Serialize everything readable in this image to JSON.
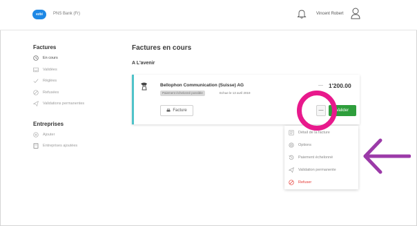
{
  "header": {
    "logo_text": "ezbi",
    "bank_name": "PNS Bank (Fr)",
    "user_name": "Vincent Robert"
  },
  "sidebar": {
    "invoices_title": "Factures",
    "invoice_items": [
      {
        "label": "En cours",
        "icon": "clock-icon",
        "active": true
      },
      {
        "label": "Validées",
        "icon": "inbox-icon",
        "active": false
      },
      {
        "label": "Réglées",
        "icon": "check-icon",
        "active": false
      },
      {
        "label": "Refusées",
        "icon": "cancel-icon",
        "active": false
      },
      {
        "label": "Validations permanentes",
        "icon": "send-icon",
        "active": false
      }
    ],
    "companies_title": "Entreprises",
    "company_items": [
      {
        "label": "Ajouter",
        "icon": "add-icon"
      },
      {
        "label": "Entreprises ajoutées",
        "icon": "building-icon"
      }
    ]
  },
  "main": {
    "title": "Factures en cours",
    "subtitle": "A L'avenir",
    "card": {
      "company": "Bellophon Communication (Suisse) AG",
      "tag": "Paiement échelonné possible",
      "due": "Echue le 13 avril 2019",
      "amount_dash": "—",
      "amount": "1'200.00",
      "invoice_button": "Facture",
      "more_button": "—",
      "validate_button": "Valider"
    }
  },
  "dropdown": {
    "items": [
      {
        "label": "Détail de la facture",
        "icon": "document-icon",
        "danger": false
      },
      {
        "label": "Options",
        "icon": "settings-icon",
        "danger": false
      },
      {
        "label": "Paiement échelonné",
        "icon": "history-icon",
        "danger": false
      },
      {
        "label": "Validation permanente",
        "icon": "send-icon",
        "danger": false
      },
      {
        "label": "Refuser",
        "icon": "cancel-icon",
        "danger": true
      }
    ]
  },
  "colors": {
    "accent_green": "#2e9e3c",
    "card_border": "#4fc3c9",
    "highlight_ring": "#e8198c",
    "arrow": "#9b3aa8",
    "danger": "#e53935"
  }
}
